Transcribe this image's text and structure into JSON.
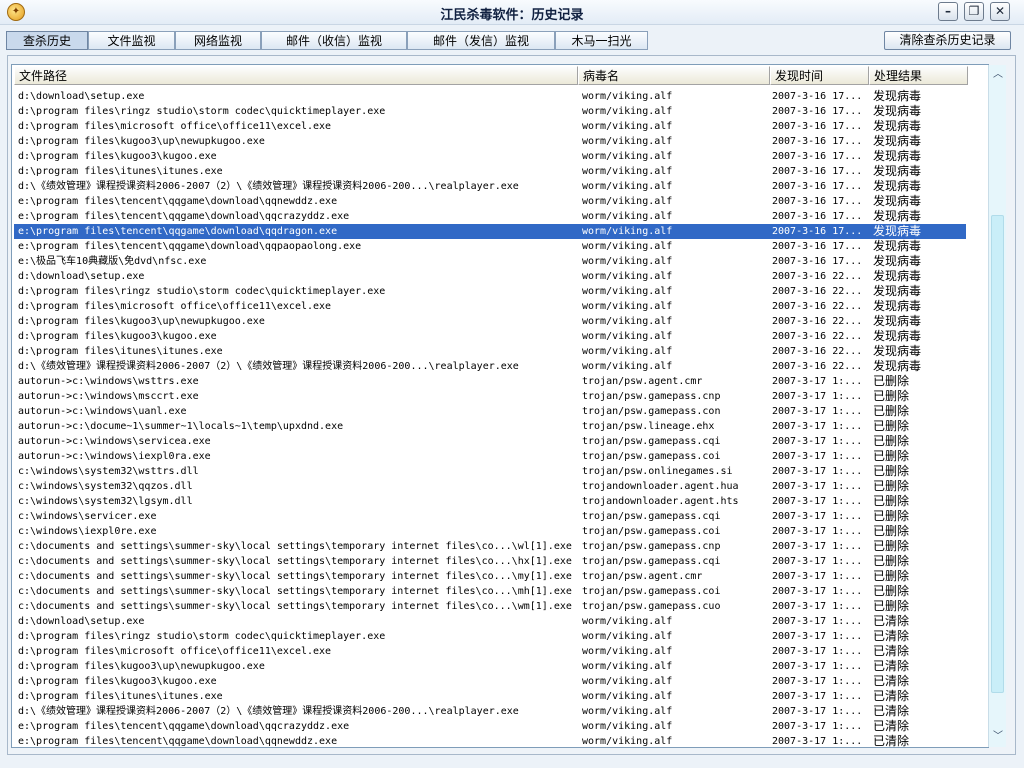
{
  "window": {
    "title": "江民杀毒软件：历史记录",
    "icon_glyph": "✦",
    "minimize_glyph": "–",
    "restore_glyph": "❐",
    "close_glyph": "✕"
  },
  "tabs": [
    {
      "label": "查杀历史",
      "active": true
    },
    {
      "label": "文件监视"
    },
    {
      "label": "网络监视"
    },
    {
      "label": "邮件（收信）监视"
    },
    {
      "label": "邮件（发信）监视"
    },
    {
      "label": "木马一扫光"
    }
  ],
  "clear_button": "清除查杀历史记录",
  "columns": [
    "文件路径",
    "病毒名",
    "发现时间",
    "处理结果"
  ],
  "scrollbar": {
    "up": "︿",
    "down": "﹀"
  },
  "rows": [
    {
      "path": "d:\\download\\setup.exe",
      "virus": "worm/viking.alf",
      "time": "2007-3-16 17...",
      "result": "发现病毒"
    },
    {
      "path": "d:\\program files\\ringz studio\\storm codec\\quicktimeplayer.exe",
      "virus": "worm/viking.alf",
      "time": "2007-3-16 17...",
      "result": "发现病毒"
    },
    {
      "path": "d:\\program files\\microsoft office\\office11\\excel.exe",
      "virus": "worm/viking.alf",
      "time": "2007-3-16 17...",
      "result": "发现病毒"
    },
    {
      "path": "d:\\program files\\kugoo3\\up\\newupkugoo.exe",
      "virus": "worm/viking.alf",
      "time": "2007-3-16 17...",
      "result": "发现病毒"
    },
    {
      "path": "d:\\program files\\kugoo3\\kugoo.exe",
      "virus": "worm/viking.alf",
      "time": "2007-3-16 17...",
      "result": "发现病毒"
    },
    {
      "path": "d:\\program files\\itunes\\itunes.exe",
      "virus": "worm/viking.alf",
      "time": "2007-3-16 17...",
      "result": "发现病毒"
    },
    {
      "path": "d:\\《绩效管理》课程授课资料2006-2007（2）\\《绩效管理》课程授课资料2006-200...\\realplayer.exe",
      "virus": "worm/viking.alf",
      "time": "2007-3-16 17...",
      "result": "发现病毒"
    },
    {
      "path": "e:\\program files\\tencent\\qqgame\\download\\qqnewddz.exe",
      "virus": "worm/viking.alf",
      "time": "2007-3-16 17...",
      "result": "发现病毒"
    },
    {
      "path": "e:\\program files\\tencent\\qqgame\\download\\qqcrazyddz.exe",
      "virus": "worm/viking.alf",
      "time": "2007-3-16 17...",
      "result": "发现病毒"
    },
    {
      "path": "e:\\program files\\tencent\\qqgame\\download\\qqdragon.exe",
      "virus": "worm/viking.alf",
      "time": "2007-3-16 17...",
      "result": "发现病毒",
      "selected": true
    },
    {
      "path": "e:\\program files\\tencent\\qqgame\\download\\qqpaopaolong.exe",
      "virus": "worm/viking.alf",
      "time": "2007-3-16 17...",
      "result": "发现病毒"
    },
    {
      "path": "e:\\极品飞车10典藏版\\免dvd\\nfsc.exe",
      "virus": "worm/viking.alf",
      "time": "2007-3-16 17...",
      "result": "发现病毒"
    },
    {
      "path": "d:\\download\\setup.exe",
      "virus": "worm/viking.alf",
      "time": "2007-3-16 22...",
      "result": "发现病毒"
    },
    {
      "path": "d:\\program files\\ringz studio\\storm codec\\quicktimeplayer.exe",
      "virus": "worm/viking.alf",
      "time": "2007-3-16 22...",
      "result": "发现病毒"
    },
    {
      "path": "d:\\program files\\microsoft office\\office11\\excel.exe",
      "virus": "worm/viking.alf",
      "time": "2007-3-16 22...",
      "result": "发现病毒"
    },
    {
      "path": "d:\\program files\\kugoo3\\up\\newupkugoo.exe",
      "virus": "worm/viking.alf",
      "time": "2007-3-16 22...",
      "result": "发现病毒"
    },
    {
      "path": "d:\\program files\\kugoo3\\kugoo.exe",
      "virus": "worm/viking.alf",
      "time": "2007-3-16 22...",
      "result": "发现病毒"
    },
    {
      "path": "d:\\program files\\itunes\\itunes.exe",
      "virus": "worm/viking.alf",
      "time": "2007-3-16 22...",
      "result": "发现病毒"
    },
    {
      "path": "d:\\《绩效管理》课程授课资料2006-2007（2）\\《绩效管理》课程授课资料2006-200...\\realplayer.exe",
      "virus": "worm/viking.alf",
      "time": "2007-3-16 22...",
      "result": "发现病毒"
    },
    {
      "path": "autorun->c:\\windows\\wsttrs.exe",
      "virus": "trojan/psw.agent.cmr",
      "time": "2007-3-17 1:...",
      "result": "已删除"
    },
    {
      "path": "autorun->c:\\windows\\msccrt.exe",
      "virus": "trojan/psw.gamepass.cnp",
      "time": "2007-3-17 1:...",
      "result": "已删除"
    },
    {
      "path": "autorun->c:\\windows\\uanl.exe",
      "virus": "trojan/psw.gamepass.con",
      "time": "2007-3-17 1:...",
      "result": "已删除"
    },
    {
      "path": "autorun->c:\\docume~1\\summer~1\\locals~1\\temp\\upxdnd.exe",
      "virus": "trojan/psw.lineage.ehx",
      "time": "2007-3-17 1:...",
      "result": "已删除"
    },
    {
      "path": "autorun->c:\\windows\\servicea.exe",
      "virus": "trojan/psw.gamepass.cqi",
      "time": "2007-3-17 1:...",
      "result": "已删除"
    },
    {
      "path": "autorun->c:\\windows\\iexpl0ra.exe",
      "virus": "trojan/psw.gamepass.coi",
      "time": "2007-3-17 1:...",
      "result": "已删除"
    },
    {
      "path": "c:\\windows\\system32\\wsttrs.dll",
      "virus": "trojan/psw.onlinegames.si",
      "time": "2007-3-17 1:...",
      "result": "已删除"
    },
    {
      "path": "c:\\windows\\system32\\qqzos.dll",
      "virus": "trojandownloader.agent.hua",
      "time": "2007-3-17 1:...",
      "result": "已删除"
    },
    {
      "path": "c:\\windows\\system32\\lgsym.dll",
      "virus": "trojandownloader.agent.hts",
      "time": "2007-3-17 1:...",
      "result": "已删除"
    },
    {
      "path": "c:\\windows\\servicer.exe",
      "virus": "trojan/psw.gamepass.cqi",
      "time": "2007-3-17 1:...",
      "result": "已删除"
    },
    {
      "path": "c:\\windows\\iexpl0re.exe",
      "virus": "trojan/psw.gamepass.coi",
      "time": "2007-3-17 1:...",
      "result": "已删除"
    },
    {
      "path": "c:\\documents and settings\\summer-sky\\local settings\\temporary internet files\\co...\\wl[1].exe",
      "virus": "trojan/psw.gamepass.cnp",
      "time": "2007-3-17 1:...",
      "result": "已删除"
    },
    {
      "path": "c:\\documents and settings\\summer-sky\\local settings\\temporary internet files\\co...\\hx[1].exe",
      "virus": "trojan/psw.gamepass.cqi",
      "time": "2007-3-17 1:...",
      "result": "已删除"
    },
    {
      "path": "c:\\documents and settings\\summer-sky\\local settings\\temporary internet files\\co...\\my[1].exe",
      "virus": "trojan/psw.agent.cmr",
      "time": "2007-3-17 1:...",
      "result": "已删除"
    },
    {
      "path": "c:\\documents and settings\\summer-sky\\local settings\\temporary internet files\\co...\\mh[1].exe",
      "virus": "trojan/psw.gamepass.coi",
      "time": "2007-3-17 1:...",
      "result": "已删除"
    },
    {
      "path": "c:\\documents and settings\\summer-sky\\local settings\\temporary internet files\\co...\\wm[1].exe",
      "virus": "trojan/psw.gamepass.cuo",
      "time": "2007-3-17 1:...",
      "result": "已删除"
    },
    {
      "path": "d:\\download\\setup.exe",
      "virus": "worm/viking.alf",
      "time": "2007-3-17 1:...",
      "result": "已清除"
    },
    {
      "path": "d:\\program files\\ringz studio\\storm codec\\quicktimeplayer.exe",
      "virus": "worm/viking.alf",
      "time": "2007-3-17 1:...",
      "result": "已清除"
    },
    {
      "path": "d:\\program files\\microsoft office\\office11\\excel.exe",
      "virus": "worm/viking.alf",
      "time": "2007-3-17 1:...",
      "result": "已清除"
    },
    {
      "path": "d:\\program files\\kugoo3\\up\\newupkugoo.exe",
      "virus": "worm/viking.alf",
      "time": "2007-3-17 1:...",
      "result": "已清除"
    },
    {
      "path": "d:\\program files\\kugoo3\\kugoo.exe",
      "virus": "worm/viking.alf",
      "time": "2007-3-17 1:...",
      "result": "已清除"
    },
    {
      "path": "d:\\program files\\itunes\\itunes.exe",
      "virus": "worm/viking.alf",
      "time": "2007-3-17 1:...",
      "result": "已清除"
    },
    {
      "path": "d:\\《绩效管理》课程授课资料2006-2007（2）\\《绩效管理》课程授课资料2006-200...\\realplayer.exe",
      "virus": "worm/viking.alf",
      "time": "2007-3-17 1:...",
      "result": "已清除"
    },
    {
      "path": "e:\\program files\\tencent\\qqgame\\download\\qqcrazyddz.exe",
      "virus": "worm/viking.alf",
      "time": "2007-3-17 1:...",
      "result": "已清除"
    },
    {
      "path": "e:\\program files\\tencent\\qqgame\\download\\qqnewddz.exe",
      "virus": "worm/viking.alf",
      "time": "2007-3-17 1:...",
      "result": "已清除"
    }
  ]
}
